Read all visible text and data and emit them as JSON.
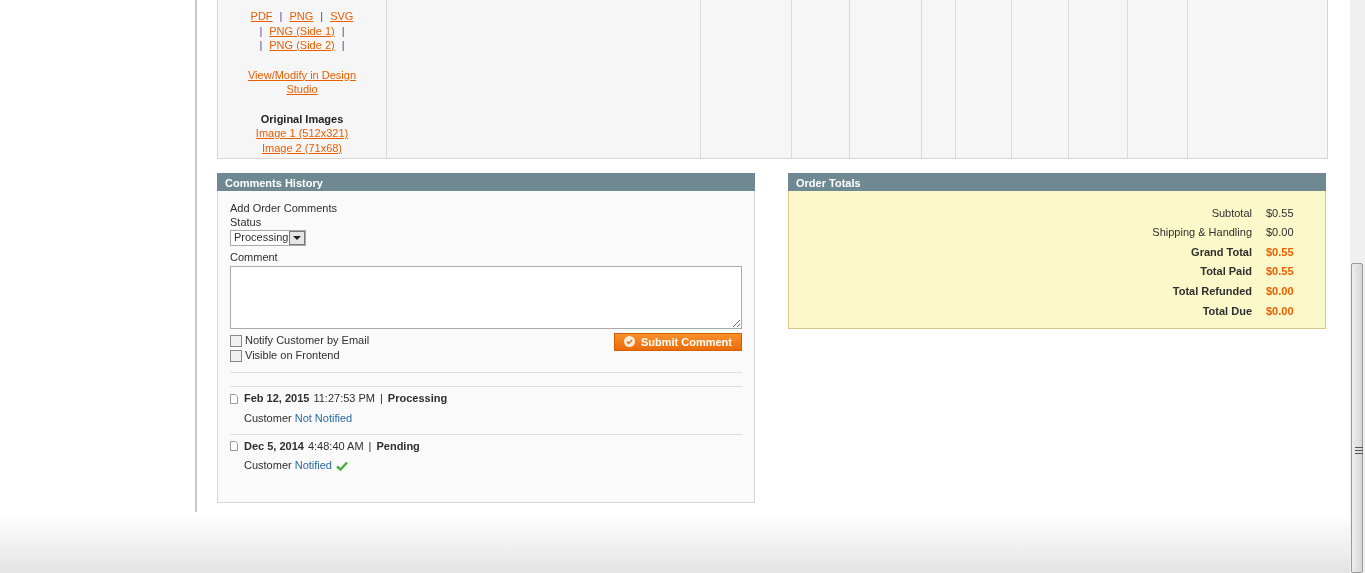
{
  "item_cell": {
    "link_lines": [
      [
        {
          "kind": "link",
          "text": "PDF"
        },
        {
          "kind": "sep",
          "text": "|"
        },
        {
          "kind": "link",
          "text": "PNG"
        },
        {
          "kind": "sep",
          "text": "|"
        },
        {
          "kind": "link",
          "text": "SVG"
        }
      ],
      [
        {
          "kind": "sep",
          "text": "|"
        },
        {
          "kind": "link",
          "text": "PNG (Side 1)"
        },
        {
          "kind": "sep",
          "text": "|"
        }
      ],
      [
        {
          "kind": "sep",
          "text": "|"
        },
        {
          "kind": "link",
          "text": "PNG (Side 2)"
        },
        {
          "kind": "sep",
          "text": "|"
        }
      ]
    ],
    "design_link": "View/Modify in Design Studio",
    "images_heading": "Original Images",
    "image_links": [
      "Image 1 (512x321)",
      "Image 2 (71x68)"
    ]
  },
  "comments": {
    "title": "Comments History",
    "subtitle": "Add Order Comments",
    "status_label": "Status",
    "status_value": "Processing",
    "comment_label": "Comment",
    "options": [
      {
        "label": "Notify Customer by Email",
        "checked": false
      },
      {
        "label": "Visible on Frontend",
        "checked": false
      }
    ],
    "submit": "Submit Comment",
    "history": [
      {
        "date": "Feb 12, 2015",
        "time": "11:27:53 PM",
        "sep": "|",
        "status": "Processing",
        "customer": "Customer",
        "notice": "Not Notified",
        "notified": false
      },
      {
        "date": "Dec 5, 2014",
        "time": "4:48:40 AM",
        "sep": "|",
        "status": "Pending",
        "customer": "Customer",
        "notice": "Notified",
        "notified": true
      }
    ]
  },
  "totals": {
    "title": "Order Totals",
    "rows": [
      {
        "label": "Subtotal",
        "value": "$0.55",
        "strong": false
      },
      {
        "label": "Shipping & Handling",
        "value": "$0.00",
        "strong": false
      },
      {
        "label": "Grand Total",
        "value": "$0.55",
        "strong": true
      },
      {
        "label": "Total Paid",
        "value": "$0.55",
        "strong": true
      },
      {
        "label": "Total Refunded",
        "value": "$0.00",
        "strong": true
      },
      {
        "label": "Total Due",
        "value": "$0.00",
        "strong": true
      }
    ]
  }
}
